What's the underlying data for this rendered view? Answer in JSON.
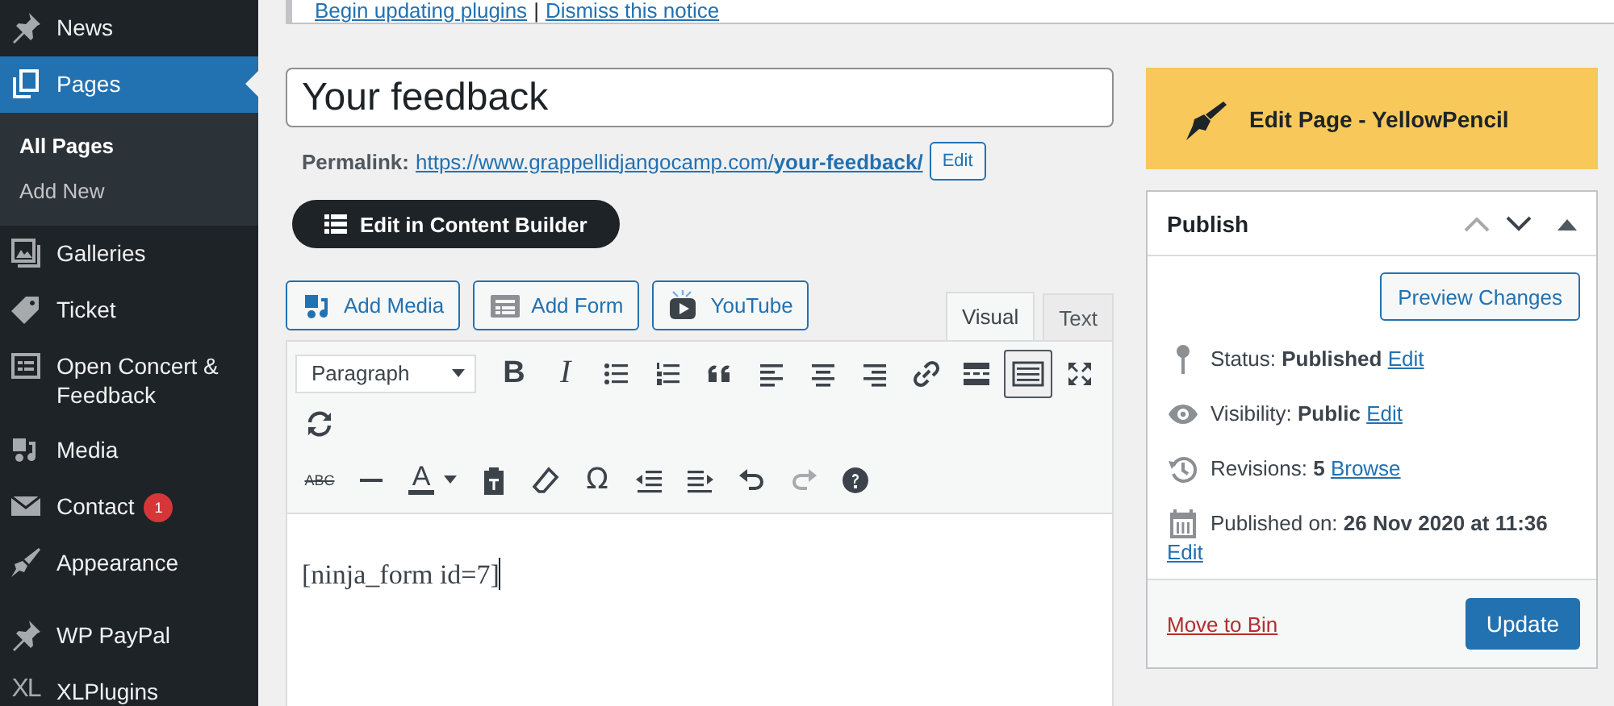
{
  "sidebar": {
    "items": [
      {
        "label": "News",
        "kind": "pin",
        "selected": false
      },
      {
        "label": "Pages",
        "kind": "pages",
        "selected": true,
        "children": [
          {
            "label": "All Pages",
            "selected": true
          },
          {
            "label": "Add New",
            "selected": false
          }
        ]
      },
      {
        "label": "Galleries",
        "kind": "gallery",
        "selected": false
      },
      {
        "label": "Ticket",
        "kind": "tag",
        "selected": false
      },
      {
        "label": "Open Concert & Feedback",
        "kind": "form",
        "selected": false
      },
      {
        "label": "Media",
        "kind": "media",
        "selected": false
      },
      {
        "label": "Contact",
        "kind": "mail",
        "selected": false,
        "badge": "1"
      },
      {
        "label": "Appearance",
        "kind": "brush",
        "selected": false
      },
      {
        "label": "WP PayPal",
        "kind": "pin",
        "selected": false,
        "separator_before": true
      },
      {
        "label": "XLPlugins",
        "kind": "lettermark",
        "mark": "XL",
        "selected": false
      }
    ]
  },
  "notice": {
    "links": [
      "Begin updating plugins",
      "Dismiss this notice"
    ],
    "separator": "|"
  },
  "title_field": {
    "value": "Your feedback"
  },
  "permalink": {
    "label": "Permalink:",
    "url": "https://www.grappellidjangocamp.com/**your-feedback/**",
    "edit": "Edit"
  },
  "content_builder_button": "Edit in Content Builder",
  "media_buttons": [
    {
      "label": "Add Media",
      "kind": "media"
    },
    {
      "label": "Add Form",
      "kind": "form"
    },
    {
      "label": "YouTube",
      "kind": "video"
    }
  ],
  "editor_tabs": [
    {
      "label": "Visual",
      "selected": true
    },
    {
      "label": "Text",
      "selected": false
    }
  ],
  "toolbar_rows": [
    [
      {
        "kind": "select",
        "text": "Paragraph"
      },
      {
        "kind": "bold",
        "text": "B",
        "pressed": false,
        "disabled": false
      },
      {
        "kind": "italic",
        "text": "I",
        "pressed": false,
        "disabled": false
      },
      {
        "kind": "bullets",
        "pressed": false,
        "disabled": false
      },
      {
        "kind": "numbers",
        "pressed": false,
        "disabled": false
      },
      {
        "kind": "quote",
        "pressed": false,
        "disabled": false
      },
      {
        "kind": "alignleft",
        "pressed": false,
        "disabled": false
      },
      {
        "kind": "aligncenter",
        "pressed": false,
        "disabled": false
      },
      {
        "kind": "alignright",
        "pressed": false,
        "disabled": false
      },
      {
        "kind": "link",
        "pressed": false,
        "disabled": false
      },
      {
        "kind": "more",
        "pressed": false,
        "disabled": false
      },
      {
        "kind": "toolbar",
        "pressed": true,
        "disabled": false
      },
      {
        "kind": "fullscreen",
        "pressed": false,
        "disabled": false
      }
    ],
    [
      {
        "kind": "refresh",
        "pressed": false,
        "disabled": false
      }
    ],
    [
      {
        "kind": "strike",
        "text": "ABC",
        "pressed": false,
        "disabled": false
      },
      {
        "kind": "hr",
        "pressed": false,
        "disabled": false
      },
      {
        "kind": "textcolor",
        "text": "A",
        "pressed": false,
        "disabled": false
      },
      {
        "kind": "paste",
        "pressed": false,
        "disabled": false
      },
      {
        "kind": "eraser",
        "pressed": false,
        "disabled": false
      },
      {
        "kind": "charmap",
        "text": "Ω",
        "pressed": false,
        "disabled": false
      },
      {
        "kind": "outdent",
        "pressed": false,
        "disabled": false
      },
      {
        "kind": "indent",
        "pressed": false,
        "disabled": false
      },
      {
        "kind": "undo",
        "pressed": false,
        "disabled": false
      },
      {
        "kind": "redo",
        "pressed": false,
        "disabled": true
      },
      {
        "kind": "help",
        "pressed": false,
        "disabled": false
      }
    ]
  ],
  "editor_content": "[ninja_form id=7]",
  "yellowpencil_button": "Edit Page - YellowPencil",
  "publish": {
    "title": "Publish",
    "preview_button": "Preview Changes",
    "rows": [
      {
        "kind": "status",
        "label": "Status:",
        "value": "Published",
        "link": "Edit"
      },
      {
        "kind": "visibility",
        "label": "Visibility:",
        "value": "Public",
        "link": "Edit"
      },
      {
        "kind": "revisions",
        "label": "Revisions:",
        "value": "5",
        "link": "Browse"
      },
      {
        "kind": "date",
        "label": "Published on:",
        "value": "26 Nov 2020 at 11:36",
        "link": "Edit"
      }
    ],
    "trash_link": "Move to Bin",
    "update_button": "Update"
  }
}
